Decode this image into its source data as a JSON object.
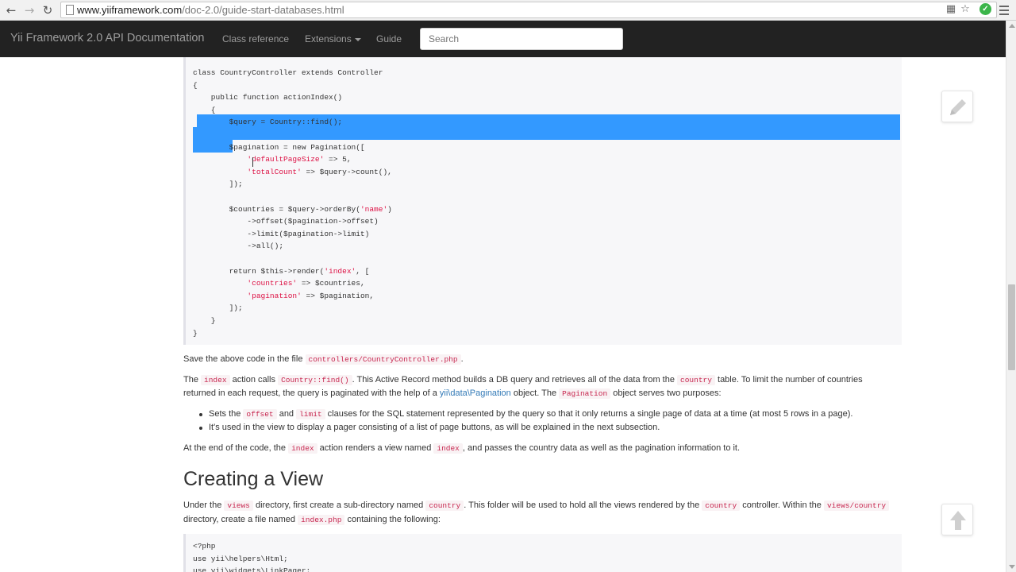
{
  "browser": {
    "url_host": "www.yiiframework.com",
    "url_path": "/doc-2.0/guide-start-databases.html"
  },
  "navbar": {
    "brand": "Yii Framework 2.0 API Documentation",
    "links": [
      "Class reference",
      "Extensions",
      "Guide"
    ],
    "search_placeholder": "Search"
  },
  "code_block_1": {
    "lines": [
      "class CountryController extends Controller",
      "{",
      "    public function actionIndex()",
      "    {",
      "        $query = Country::find();",
      "",
      "        $pagination = new Pagination([",
      "            'defaultPageSize' => 5,",
      "            'totalCount' => $query->count(),",
      "        ]);",
      "",
      "        $countries = $query->orderBy('name')",
      "            ->offset($pagination->offset)",
      "            ->limit($pagination->limit)",
      "            ->all();",
      "",
      "        return $this->render('index', [",
      "            'countries' => $countries,",
      "            'pagination' => $pagination,",
      "        ]);",
      "    }",
      "}"
    ]
  },
  "text": {
    "p1_a": "Save the above code in the file ",
    "p1_code": "controllers/CountryController.php",
    "p1_b": ".",
    "p2_a": "The ",
    "p2_code1": "index",
    "p2_b": " action calls ",
    "p2_code2": "Country::find()",
    "p2_c": ". This Active Record method builds a DB query and retrieves all of the data from the ",
    "p2_code3": "country",
    "p2_d": " table. To limit the number of countries",
    "p2_e": "returned in each request, the query is paginated with the help of a ",
    "p2_link": "yii\\data\\Pagination",
    "p2_f": " object. The ",
    "p2_code4": "Pagination",
    "p2_g": " object serves two purposes:",
    "li1_a": "Sets the ",
    "li1_code1": "offset",
    "li1_b": " and ",
    "li1_code2": "limit",
    "li1_c": " clauses for the SQL statement represented by the query so that it only returns a single page of data at a time (at most 5 rows in a page).",
    "li2": "It's used in the view to display a pager consisting of a list of page buttons, as will be explained in the next subsection.",
    "p3_a": "At the end of the code, the ",
    "p3_code1": "index",
    "p3_b": " action renders a view named ",
    "p3_code2": "index",
    "p3_c": ", and passes the country data as well as the pagination information to it.",
    "h2": "Creating a View",
    "p4_a": "Under the ",
    "p4_code1": "views",
    "p4_b": " directory, first create a sub-directory named ",
    "p4_code2": "country",
    "p4_c": ". This folder will be used to hold all the views rendered by the ",
    "p4_code3": "country",
    "p4_d": " controller. Within the ",
    "p4_code4": "views/country",
    "p4_e": "directory, create a file named ",
    "p4_code5": "index.php",
    "p4_f": " containing the following:"
  },
  "code_block_2": {
    "lines": [
      "<?php",
      "use yii\\helpers\\Html;",
      "use yii\\widgets\\LinkPager;"
    ]
  },
  "icons": {
    "edit": "pencil-icon",
    "top": "arrow-up-icon"
  },
  "colors": {
    "navbar": "#222222",
    "selection": "#3399ff",
    "link": "#337ab7",
    "inline_code": "#c7254e"
  }
}
